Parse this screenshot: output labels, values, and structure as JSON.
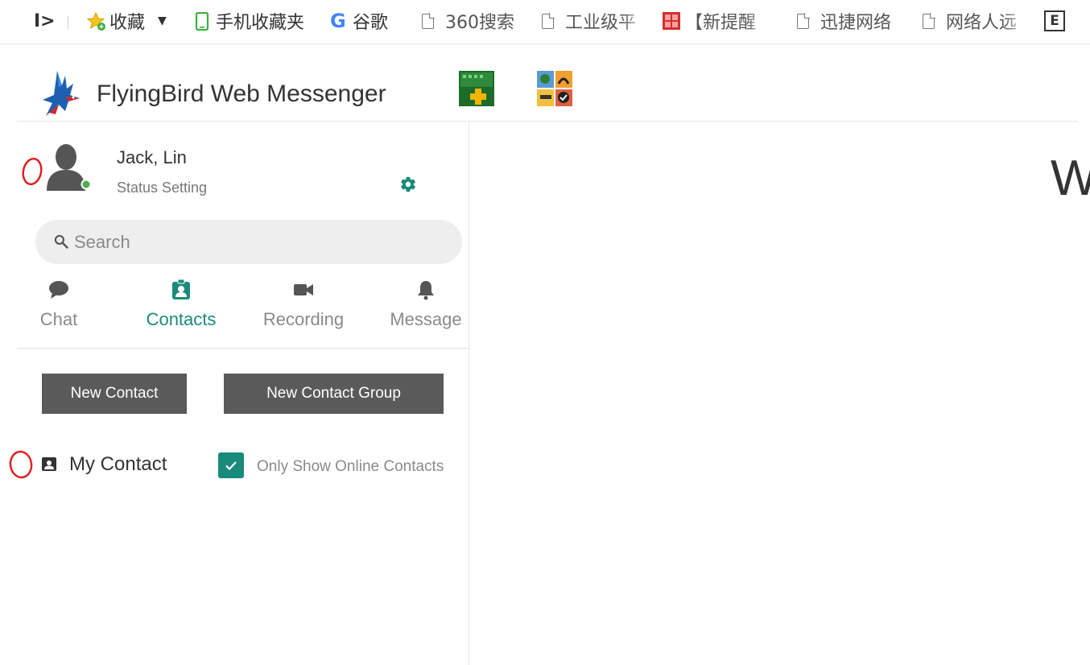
{
  "bookmarks_bar": {
    "toggle_glyph": "I>",
    "items": [
      {
        "label": "收藏",
        "icon": "star-add-icon"
      },
      {
        "label": "手机收藏夹",
        "icon": "phone-icon"
      },
      {
        "label": "谷歌",
        "icon": "google-icon"
      },
      {
        "label": "360搜索",
        "icon": "page-icon"
      },
      {
        "label": "工业级平",
        "icon": "page-icon"
      },
      {
        "label": "【新提醒",
        "icon": "red-seal-icon"
      },
      {
        "label": "迅捷网络",
        "icon": "page-icon"
      },
      {
        "label": "网络人远",
        "icon": "page-icon"
      }
    ],
    "google_glyph": "G",
    "extra_glyph": "E"
  },
  "header": {
    "app_title": "FlyingBird Web Messenger"
  },
  "user": {
    "name": "Jack, Lin",
    "status_text": "Status Setting",
    "online_color": "#4caf50"
  },
  "search": {
    "placeholder": "Search"
  },
  "tabs": [
    {
      "label": "Chat",
      "icon": "chat-bubble-icon",
      "active": false
    },
    {
      "label": "Contacts",
      "icon": "contact-badge-icon",
      "active": true
    },
    {
      "label": "Recording",
      "icon": "video-camera-icon",
      "active": false
    },
    {
      "label": "Message",
      "icon": "bell-icon",
      "active": false
    }
  ],
  "actions": {
    "new_contact": "New Contact",
    "new_contact_group": "New Contact Group"
  },
  "contacts": {
    "my_contact_label": "My Contact",
    "only_online_label": "Only Show Online Contacts",
    "only_online_checked": true
  },
  "main": {
    "welcome_partial": "W"
  },
  "colors": {
    "accent": "#1a8a7a",
    "button_bg": "#5a5a5a",
    "annotation_red": "#e02020"
  }
}
